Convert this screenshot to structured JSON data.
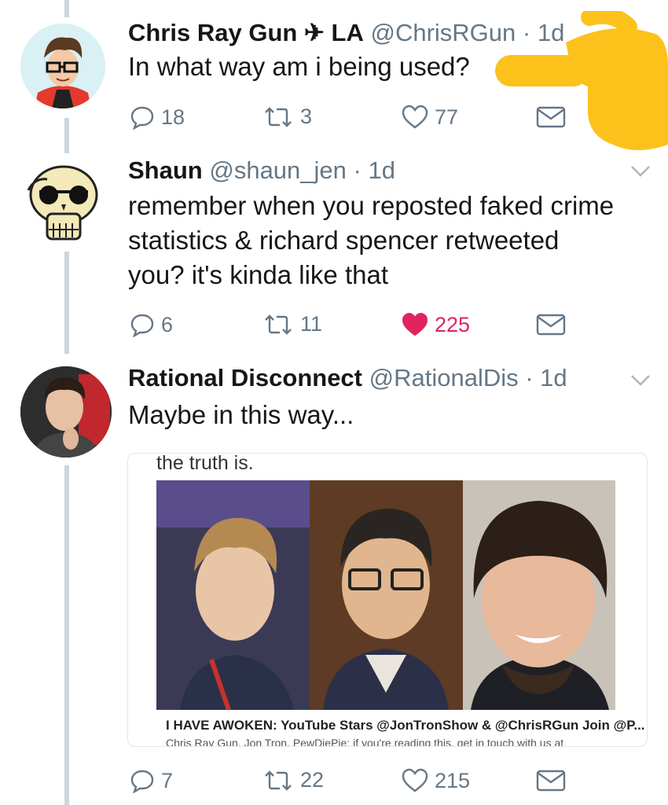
{
  "tweets": [
    {
      "display_name": "Chris Ray Gun ✈ LA",
      "handle": "@ChrisRGun",
      "time": "· 1d",
      "text": "In what way am i being used?",
      "replies": "18",
      "retweets": "3",
      "likes": "77",
      "liked": false
    },
    {
      "display_name": "Shaun",
      "handle": "@shaun_jen",
      "time": "· 1d",
      "text": "remember when you reposted faked crime statistics & richard spencer retweeted you? it's kinda like that",
      "replies": "6",
      "retweets": "11",
      "likes": "225",
      "liked": true
    },
    {
      "display_name": "Rational Disconnect",
      "handle": "@RationalDis",
      "time": "· 1d",
      "text": "Maybe in this way...",
      "replies": "7",
      "retweets": "22",
      "likes": "215",
      "liked": false
    }
  ],
  "card": {
    "top_text": "the truth is.",
    "headline": "I HAVE AWOKEN: YouTube Stars @JonTronShow & @ChrisRGun Join @P...",
    "subtext": "Chris Ray Gun, Jon Tron, PewDiePie: if you're reading this, get in touch with us at"
  },
  "colors": {
    "text": "#14171a",
    "secondary": "#657786",
    "like": "#e0245e",
    "thread_line": "#ccd6dd",
    "overlay_hand": "#fcc21b"
  },
  "icons": [
    "reply-icon",
    "retweet-icon",
    "like-icon",
    "dm-icon",
    "chevron-down-icon",
    "pointing-hand-emoji"
  ]
}
